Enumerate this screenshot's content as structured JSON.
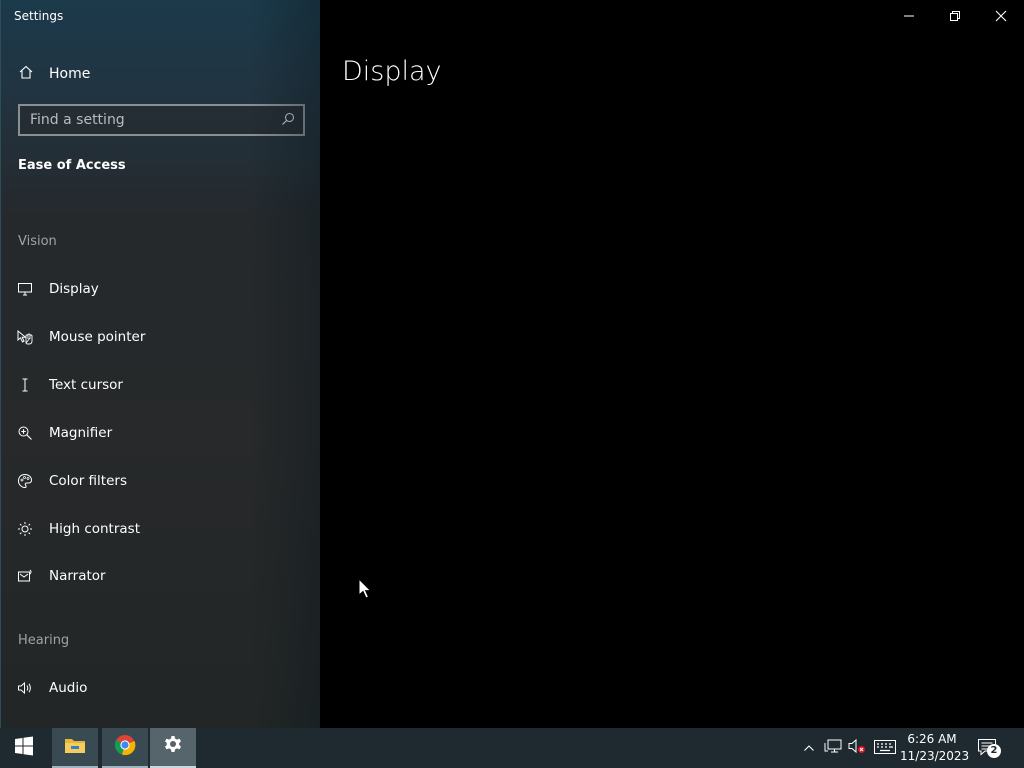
{
  "window": {
    "title": "Settings"
  },
  "sidebar": {
    "home_label": "Home",
    "search_placeholder": "Find a setting",
    "section_title": "Ease of Access",
    "groups": {
      "vision": "Vision",
      "hearing": "Hearing"
    },
    "items": [
      {
        "label": "Display",
        "icon": "monitor-icon"
      },
      {
        "label": "Mouse pointer",
        "icon": "mouse-pointer-icon"
      },
      {
        "label": "Text cursor",
        "icon": "text-cursor-icon"
      },
      {
        "label": "Magnifier",
        "icon": "magnifier-icon"
      },
      {
        "label": "Color filters",
        "icon": "palette-icon"
      },
      {
        "label": "High contrast",
        "icon": "brightness-icon"
      },
      {
        "label": "Narrator",
        "icon": "narrator-icon"
      },
      {
        "label": "Audio",
        "icon": "speaker-icon"
      }
    ]
  },
  "main": {
    "title": "Display"
  },
  "taskbar": {
    "apps": [
      "start-icon",
      "file-explorer-icon",
      "chrome-icon",
      "settings-gear-icon"
    ],
    "clock": {
      "time": "6:26 AM",
      "date": "11/23/2023"
    },
    "notifications_count": "2"
  },
  "colors": {
    "sidebar_top": "#1b3a4b",
    "sidebar_bottom": "#222626",
    "taskbar": "#1f2a30",
    "content_bg": "#000000"
  }
}
